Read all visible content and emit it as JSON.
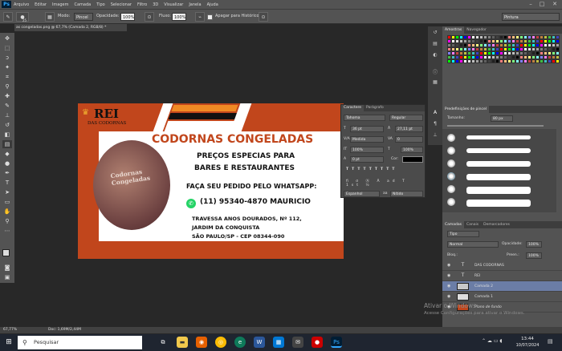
{
  "menubar": {
    "items": [
      "Arquivo",
      "Editar",
      "Imagem",
      "Camada",
      "Tipo",
      "Selecionar",
      "Filtro",
      "3D",
      "Visualizar",
      "Janela",
      "Ajuda"
    ]
  },
  "optbar": {
    "brush_size": "25",
    "mode_label": "Modo:",
    "mode_value": "Pincel",
    "opacity_label": "Opacidade:",
    "opacity_value": "100%",
    "flow_label": "Fluxo:",
    "flow_value": "100%",
    "erase_history_label": "Apagar para Histórico",
    "workspace": "Pintura"
  },
  "document": {
    "tab_title": "as congeladas.png @ 67,7% (Camada 2, RGB/8) *"
  },
  "flyer": {
    "brand": "REI",
    "brand_sub": "DAS CODORNAS",
    "photo_text": "Codornas Congeladas",
    "headline": "CODORNAS CONGELADAS",
    "prices_line1": "PREÇOS ESPECIAS PARA",
    "prices_line2": "BARES E RESTAURANTES",
    "whatsapp_label": "FAÇA SEU PEDIDO PELO WHATSAPP:",
    "phone": "(11) 95340-4870 MAURICIO",
    "address_line1": "TRAVESSA ANOS DOURADOS, Nº 112,",
    "address_line2": "JARDIM DA CONQUISTA",
    "address_line3": "SÃO PAULO/SP - CEP 08344-090",
    "colors": {
      "orange": "#c1461c",
      "black": "#111111",
      "accent": "#f08a24"
    }
  },
  "character_panel": {
    "tab_character": "Caractere",
    "tab_paragraph": "Parágrafo",
    "font_family": "Tahoma",
    "font_style": "Regular",
    "font_size": "36 pt",
    "leading": "27,11 pt",
    "kerning": "Medida",
    "tracking": "0",
    "vscale": "100%",
    "hscale": "100%",
    "baseline": "0 pt",
    "color_label": "Cor:",
    "language": "Espanhol",
    "antialias": "Nítido"
  },
  "swatches_panel": {
    "tab_swatches": "Amostras",
    "tab_browser": "Navegador",
    "colors": [
      "#ff0000",
      "#ffff00",
      "#00ff00",
      "#00ffff",
      "#0000ff",
      "#ff00ff",
      "#ffffff",
      "#e0e0e0",
      "#c0c0c0",
      "#a0a0a0",
      "#808080",
      "#606060",
      "#404040",
      "#202020",
      "#000000",
      "#ff8080",
      "#ffc080",
      "#ffff80",
      "#80ff80",
      "#80ffff",
      "#8080ff",
      "#ff80ff",
      "#c04040",
      "#c08040",
      "#c0c040",
      "#40c040",
      "#40c0c0",
      "#4040c0"
    ]
  },
  "brush_panel": {
    "title": "Predefinições de pincel",
    "size_label": "Tamanho:",
    "size_value": "80 px"
  },
  "layers_panel": {
    "tab_layers": "Camadas",
    "tab_channels": "Canais",
    "tab_paths": "Demarcadores",
    "kind_filter": "Tipo",
    "blend_mode": "Normal",
    "opacity_label": "Opacidade:",
    "opacity_value": "100%",
    "lock_label": "Bloq.:",
    "fill_label": "Preen.:",
    "fill_value": "100%",
    "layers": [
      {
        "name": "DAS CODORNAS",
        "type": "T"
      },
      {
        "name": "REI",
        "type": "T"
      },
      {
        "name": "Camada 2",
        "type": "img",
        "selected": true
      },
      {
        "name": "Camada 1",
        "type": "img"
      },
      {
        "name": "Plano de fundo",
        "type": "img"
      }
    ]
  },
  "status_bar": {
    "zoom": "67,77%",
    "doc": "Doc: 1,69M/2,44M"
  },
  "watermark": {
    "line1": "Ativar o Windows",
    "line2": "Acesse Configurações para ativar o Windows."
  },
  "taskbar": {
    "search_placeholder": "Pesquisar",
    "time": "13:44",
    "date": "10/07/2024"
  }
}
